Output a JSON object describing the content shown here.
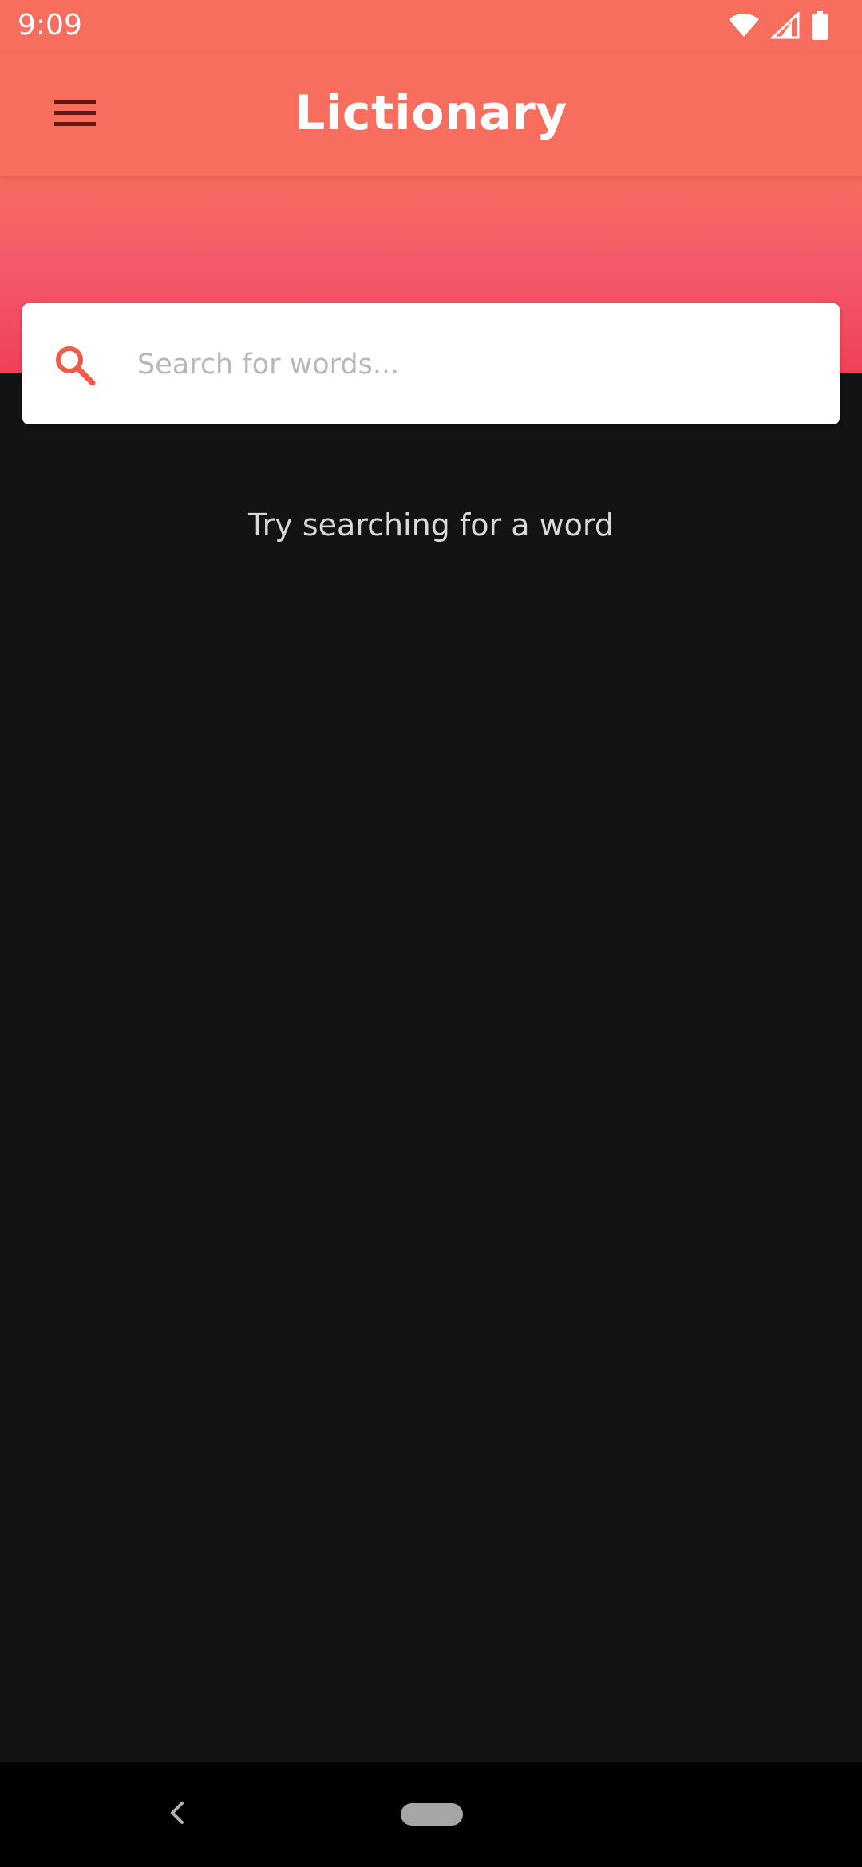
{
  "status_bar": {
    "time": "9:09",
    "icons": [
      "wifi-icon",
      "cell-signal-icon",
      "battery-icon"
    ]
  },
  "app_bar": {
    "title": "Lictionary",
    "menu_icon": "hamburger-menu-icon"
  },
  "search": {
    "placeholder": "Search for words...",
    "value": "",
    "icon": "search-icon"
  },
  "empty_state": {
    "message": "Try searching for a word"
  },
  "navigation_bar": {
    "back_icon": "back-chevron-icon",
    "home_icon": "home-pill-icon"
  },
  "colors": {
    "app_bar": "#f76d5e",
    "gradient_bottom": "#ef4157",
    "accent": "#f05a4a",
    "background": "#131313",
    "menu_icon": "#5a1a16",
    "hint_text": "#d9d9d9"
  }
}
